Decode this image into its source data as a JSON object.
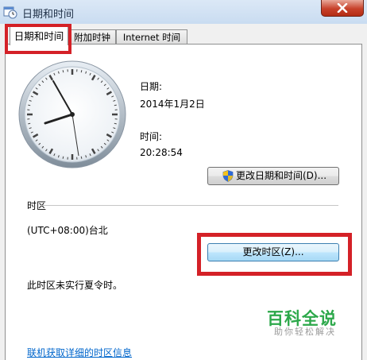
{
  "window": {
    "title": "日期和时间"
  },
  "tabs": [
    {
      "label": "日期和时间",
      "selected": true
    },
    {
      "label": "附加时钟",
      "selected": false
    },
    {
      "label": "Internet 时间",
      "selected": false
    }
  ],
  "datetime": {
    "date_label": "日期:",
    "date_value": "2014年1月2日",
    "time_label": "时间:",
    "time_value": "20:28:54",
    "change_datetime_button": "更改日期和时间(D)..."
  },
  "timezone": {
    "section_label": "时区",
    "value": "(UTC+08:00)台北",
    "change_button": "更改时区(Z)...",
    "dst_note": "此时区未实行夏令时。"
  },
  "link_text": "联机获取详细的时区信息",
  "watermark": {
    "title": "百科全说",
    "subtitle": "助你轻松解决"
  },
  "colors": {
    "highlight": "#d42127",
    "link": "#0066cc",
    "watermark": "#2ca84a"
  },
  "icons": {
    "window": "calendar-clock-icon",
    "uac_shield": "shield-icon",
    "close": "close-icon"
  }
}
